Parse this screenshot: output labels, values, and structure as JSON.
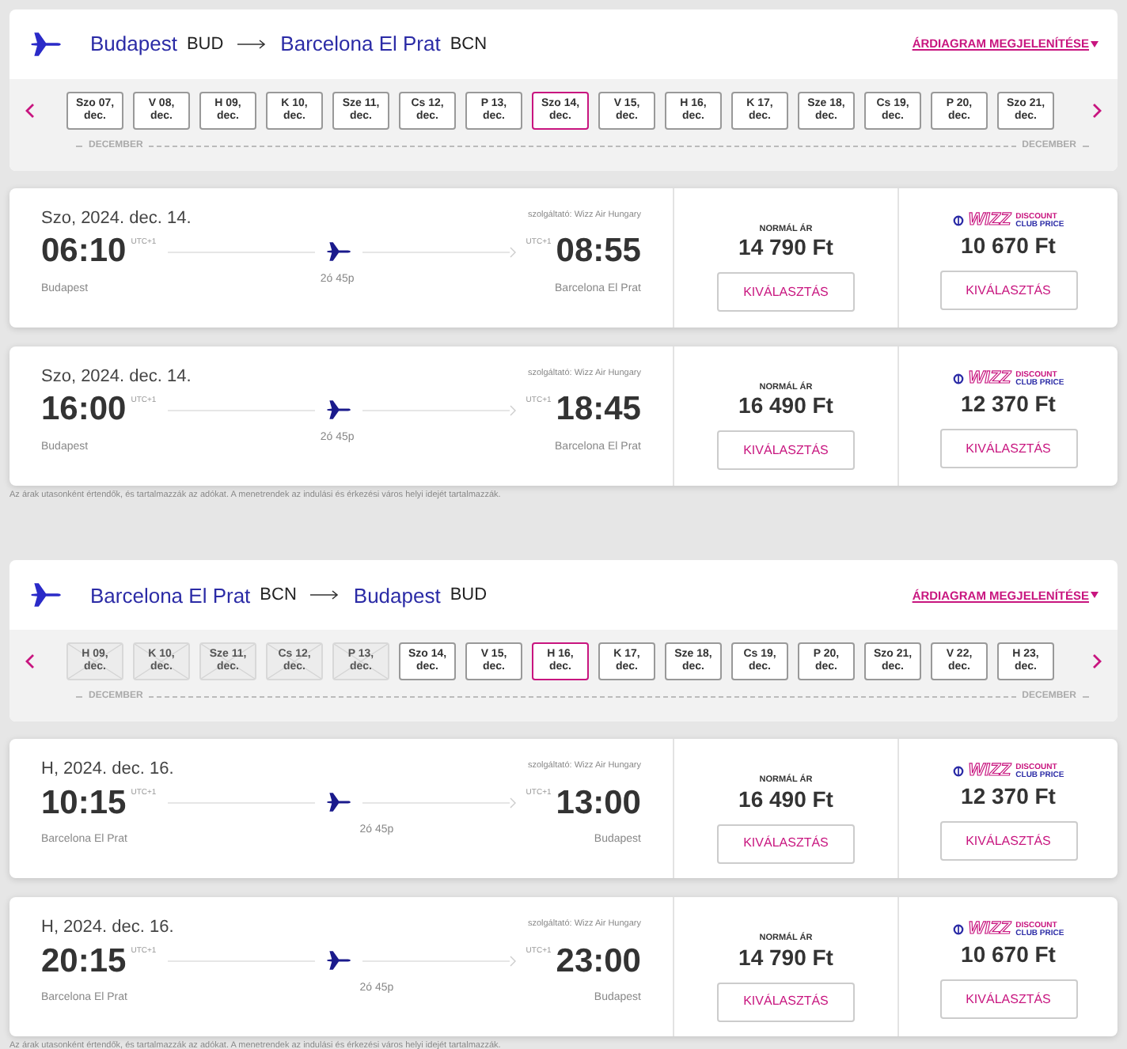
{
  "sections": [
    {
      "origin": {
        "city": "Budapest",
        "code": "BUD"
      },
      "destination": {
        "city": "Barcelona El Prat",
        "code": "BCN"
      },
      "chart_link": "ÁRDIAGRAM MEGJELENÍTÉSE",
      "month_labels": [
        "DECEMBER",
        "DECEMBER"
      ],
      "dates": [
        {
          "day": "Szo 07,",
          "month": "dec.",
          "selected": false,
          "disabled": false
        },
        {
          "day": "V 08,",
          "month": "dec.",
          "selected": false,
          "disabled": false
        },
        {
          "day": "H 09,",
          "month": "dec.",
          "selected": false,
          "disabled": false
        },
        {
          "day": "K 10,",
          "month": "dec.",
          "selected": false,
          "disabled": false
        },
        {
          "day": "Sze 11,",
          "month": "dec.",
          "selected": false,
          "disabled": false
        },
        {
          "day": "Cs 12,",
          "month": "dec.",
          "selected": false,
          "disabled": false
        },
        {
          "day": "P 13,",
          "month": "dec.",
          "selected": false,
          "disabled": false
        },
        {
          "day": "Szo 14,",
          "month": "dec.",
          "selected": true,
          "disabled": false
        },
        {
          "day": "V 15,",
          "month": "dec.",
          "selected": false,
          "disabled": false
        },
        {
          "day": "H 16,",
          "month": "dec.",
          "selected": false,
          "disabled": false
        },
        {
          "day": "K 17,",
          "month": "dec.",
          "selected": false,
          "disabled": false
        },
        {
          "day": "Sze 18,",
          "month": "dec.",
          "selected": false,
          "disabled": false
        },
        {
          "day": "Cs 19,",
          "month": "dec.",
          "selected": false,
          "disabled": false
        },
        {
          "day": "P 20,",
          "month": "dec.",
          "selected": false,
          "disabled": false
        },
        {
          "day": "Szo 21,",
          "month": "dec.",
          "selected": false,
          "disabled": false
        }
      ],
      "flights": [
        {
          "date": "Szo, 2024. dec. 14.",
          "operator": "szolgáltató: Wizz Air Hungary",
          "dep_time": "06:10",
          "dep_tz": "UTC+1",
          "arr_time": "08:55",
          "arr_tz": "UTC+1",
          "duration": "2ó 45p",
          "dep_city": "Budapest",
          "arr_city": "Barcelona El Prat",
          "normal_label": "NORMÁL ÁR",
          "normal_price": "14 790 Ft",
          "club_logo": "WIZZ",
          "club_label": "DISCOUNT",
          "club_label2": "CLUB PRICE",
          "club_price": "10 670 Ft",
          "select": "KIVÁLASZTÁS",
          "select2": "KIVÁLASZTÁS"
        },
        {
          "date": "Szo, 2024. dec. 14.",
          "operator": "szolgáltató: Wizz Air Hungary",
          "dep_time": "16:00",
          "dep_tz": "UTC+1",
          "arr_time": "18:45",
          "arr_tz": "UTC+1",
          "duration": "2ó 45p",
          "dep_city": "Budapest",
          "arr_city": "Barcelona El Prat",
          "normal_label": "NORMÁL ÁR",
          "normal_price": "16 490 Ft",
          "club_logo": "WIZZ",
          "club_label": "DISCOUNT",
          "club_label2": "CLUB PRICE",
          "club_price": "12 370 Ft",
          "select": "KIVÁLASZTÁS",
          "select2": "KIVÁLASZTÁS"
        }
      ],
      "note": "Az árak utasonként értendők, és tartalmazzák az adókat. A menetrendek az indulási és érkezési város helyi idejét tartalmazzák."
    },
    {
      "origin": {
        "city": "Barcelona El Prat",
        "code": "BCN"
      },
      "destination": {
        "city": "Budapest",
        "code": "BUD"
      },
      "chart_link": "ÁRDIAGRAM MEGJELENÍTÉSE",
      "month_labels": [
        "DECEMBER",
        "DECEMBER"
      ],
      "dates": [
        {
          "day": "H 09,",
          "month": "dec.",
          "selected": false,
          "disabled": true
        },
        {
          "day": "K 10,",
          "month": "dec.",
          "selected": false,
          "disabled": true
        },
        {
          "day": "Sze 11,",
          "month": "dec.",
          "selected": false,
          "disabled": true
        },
        {
          "day": "Cs 12,",
          "month": "dec.",
          "selected": false,
          "disabled": true
        },
        {
          "day": "P 13,",
          "month": "dec.",
          "selected": false,
          "disabled": true
        },
        {
          "day": "Szo 14,",
          "month": "dec.",
          "selected": false,
          "disabled": false
        },
        {
          "day": "V 15,",
          "month": "dec.",
          "selected": false,
          "disabled": false
        },
        {
          "day": "H 16,",
          "month": "dec.",
          "selected": true,
          "disabled": false
        },
        {
          "day": "K 17,",
          "month": "dec.",
          "selected": false,
          "disabled": false
        },
        {
          "day": "Sze 18,",
          "month": "dec.",
          "selected": false,
          "disabled": false
        },
        {
          "day": "Cs 19,",
          "month": "dec.",
          "selected": false,
          "disabled": false
        },
        {
          "day": "P 20,",
          "month": "dec.",
          "selected": false,
          "disabled": false
        },
        {
          "day": "Szo 21,",
          "month": "dec.",
          "selected": false,
          "disabled": false
        },
        {
          "day": "V 22,",
          "month": "dec.",
          "selected": false,
          "disabled": false
        },
        {
          "day": "H 23,",
          "month": "dec.",
          "selected": false,
          "disabled": false
        }
      ],
      "flights": [
        {
          "date": "H, 2024. dec. 16.",
          "operator": "szolgáltató: Wizz Air Hungary",
          "dep_time": "10:15",
          "dep_tz": "UTC+1",
          "arr_time": "13:00",
          "arr_tz": "UTC+1",
          "duration": "2ó 45p",
          "dep_city": "Barcelona El Prat",
          "arr_city": "Budapest",
          "normal_label": "NORMÁL ÁR",
          "normal_price": "16 490 Ft",
          "club_logo": "WIZZ",
          "club_label": "DISCOUNT",
          "club_label2": "CLUB PRICE",
          "club_price": "12 370 Ft",
          "select": "KIVÁLASZTÁS",
          "select2": "KIVÁLASZTÁS"
        },
        {
          "date": "H, 2024. dec. 16.",
          "operator": "szolgáltató: Wizz Air Hungary",
          "dep_time": "20:15",
          "dep_tz": "UTC+1",
          "arr_time": "23:00",
          "arr_tz": "UTC+1",
          "duration": "2ó 45p",
          "dep_city": "Barcelona El Prat",
          "arr_city": "Budapest",
          "normal_label": "NORMÁL ÁR",
          "normal_price": "14 790 Ft",
          "club_logo": "WIZZ",
          "club_label": "DISCOUNT",
          "club_label2": "CLUB PRICE",
          "club_price": "10 670 Ft",
          "select": "KIVÁLASZTÁS",
          "select2": "KIVÁLASZTÁS"
        }
      ],
      "note": "Az árak utasonként értendők, és tartalmazzák az adókat. A menetrendek az indulási és érkezési város helyi idejét tartalmazzák."
    }
  ]
}
